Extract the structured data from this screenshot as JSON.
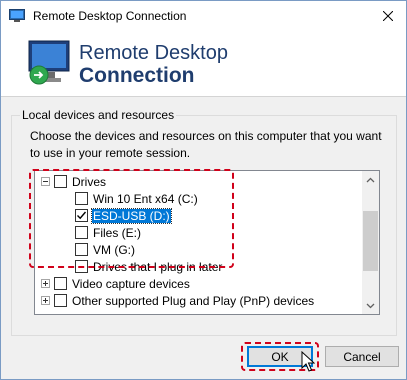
{
  "window": {
    "title": "Remote Desktop Connection",
    "icon": "remote-desktop-icon",
    "close_icon": "close-icon"
  },
  "banner": {
    "line1": "Remote Desktop",
    "line2": "Connection"
  },
  "group": {
    "label": "Local devices and resources",
    "description": "Choose the devices and resources on this computer that you want to use in your remote session."
  },
  "tree": {
    "drives": {
      "label": "Drives",
      "expanded": true,
      "checked": false
    },
    "drive_items": [
      {
        "label": "Win 10 Ent x64 (C:)",
        "checked": false
      },
      {
        "label": "ESD-USB (D:)",
        "checked": true,
        "selected": true
      },
      {
        "label": "Files (E:)",
        "checked": false
      },
      {
        "label": "VM (G:)",
        "checked": false
      },
      {
        "label": "Drives that I plug in later",
        "checked": false
      }
    ],
    "video": {
      "label": "Video capture devices",
      "expanded": false,
      "checked": false
    },
    "pnp": {
      "label": "Other supported Plug and Play (PnP) devices",
      "expanded": false,
      "checked": false
    }
  },
  "buttons": {
    "ok": "OK",
    "cancel": "Cancel"
  },
  "colors": {
    "banner_text": "#1f3d6e",
    "selection": "#0078d7",
    "highlight": "#d0021b"
  }
}
